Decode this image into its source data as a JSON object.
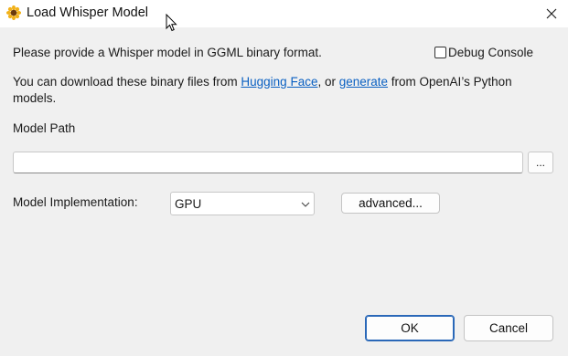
{
  "window": {
    "title": "Load Whisper Model",
    "close_glyph": "✕"
  },
  "intro": {
    "text": "Please provide a Whisper model in GGML binary format."
  },
  "debug": {
    "label": "Debug Console",
    "checked": false
  },
  "download": {
    "prefix": "You can download these binary files from ",
    "link1": "Hugging Face",
    "middle": ", or ",
    "link2": "generate",
    "suffix": " from OpenAI’s Python",
    "line2": "models."
  },
  "model_path": {
    "label": "Model Path",
    "value": "",
    "browse_label": "..."
  },
  "implementation": {
    "label": "Model Implementation:",
    "selected": "GPU",
    "advanced_label": "advanced..."
  },
  "buttons": {
    "ok": "OK",
    "cancel": "Cancel"
  },
  "icons": {
    "app": "sunflower-icon",
    "close": "close-icon",
    "chevron": "chevron-down-icon",
    "cursor": "mouse-pointer-icon"
  },
  "colors": {
    "link": "#0a60c2",
    "accent": "#2a68b8",
    "background": "#f0f0f0"
  }
}
